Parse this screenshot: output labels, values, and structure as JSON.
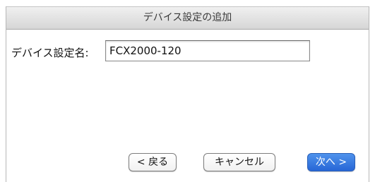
{
  "dialog": {
    "title": "デバイス設定の追加"
  },
  "form": {
    "name_label": "デバイス設定名:",
    "name_value": "FCX2000-120"
  },
  "buttons": {
    "back_label": "< 戻る",
    "cancel_label": "キャンセル",
    "next_label": "次へ >"
  },
  "colors": {
    "primary_button": "#2f74e0",
    "titlebar": "#e2e2e2"
  }
}
